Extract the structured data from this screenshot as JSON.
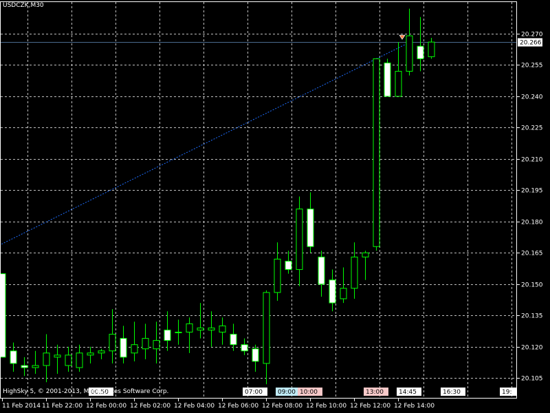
{
  "chart_data": {
    "type": "candlestick",
    "title": "USDCZK,M30",
    "ylim": [
      20.0955,
      20.2855
    ],
    "grid": true,
    "y_ticks": [
      "20.270",
      "20.255",
      "20.240",
      "20.225",
      "20.210",
      "20.195",
      "20.180",
      "20.165",
      "20.150",
      "20.135",
      "20.120",
      "20.105"
    ],
    "y_tick_values": [
      20.27,
      20.255,
      20.24,
      20.225,
      20.21,
      20.195,
      20.18,
      20.165,
      20.15,
      20.135,
      20.12,
      20.105
    ],
    "x_ticks": [
      "11 Feb 2014",
      "11 Feb 22:00",
      "12 Feb 00:00",
      "12 Feb 02:00",
      "12 Feb 04:00",
      "12 Feb 06:00",
      "12 Feb 08:00",
      "12 Feb 10:00",
      "12 Feb 12:00",
      "12 Feb 14:00"
    ],
    "candles": [
      {
        "o": 20.155,
        "h": 20.155,
        "l": 20.115,
        "c": 20.115
      },
      {
        "o": 20.118,
        "h": 20.122,
        "l": 20.108,
        "c": 20.112
      },
      {
        "o": 20.111,
        "h": 20.115,
        "l": 20.106,
        "c": 20.11
      },
      {
        "o": 20.11,
        "h": 20.118,
        "l": 20.107,
        "c": 20.111
      },
      {
        "o": 20.111,
        "h": 20.126,
        "l": 20.103,
        "c": 20.117
      },
      {
        "o": 20.115,
        "h": 20.121,
        "l": 20.107,
        "c": 20.116
      },
      {
        "o": 20.111,
        "h": 20.12,
        "l": 20.108,
        "c": 20.116
      },
      {
        "o": 20.11,
        "h": 20.121,
        "l": 20.108,
        "c": 20.117
      },
      {
        "o": 20.116,
        "h": 20.12,
        "l": 20.112,
        "c": 20.117
      },
      {
        "o": 20.117,
        "h": 20.119,
        "l": 20.114,
        "c": 20.118
      },
      {
        "o": 20.118,
        "h": 20.138,
        "l": 20.112,
        "c": 20.126
      },
      {
        "o": 20.124,
        "h": 20.13,
        "l": 20.112,
        "c": 20.115
      },
      {
        "o": 20.117,
        "h": 20.132,
        "l": 20.113,
        "c": 20.121
      },
      {
        "o": 20.119,
        "h": 20.131,
        "l": 20.114,
        "c": 20.124
      },
      {
        "o": 20.119,
        "h": 20.132,
        "l": 20.112,
        "c": 20.123
      },
      {
        "o": 20.128,
        "h": 20.137,
        "l": 20.118,
        "c": 20.123
      },
      {
        "o": 20.127,
        "h": 20.133,
        "l": 20.121,
        "c": 20.127
      },
      {
        "o": 20.127,
        "h": 20.134,
        "l": 20.117,
        "c": 20.131
      },
      {
        "o": 20.128,
        "h": 20.141,
        "l": 20.124,
        "c": 20.129
      },
      {
        "o": 20.128,
        "h": 20.137,
        "l": 20.12,
        "c": 20.129
      },
      {
        "o": 20.127,
        "h": 20.134,
        "l": 20.121,
        "c": 20.13
      },
      {
        "o": 20.126,
        "h": 20.131,
        "l": 20.118,
        "c": 20.121
      },
      {
        "o": 20.121,
        "h": 20.124,
        "l": 20.116,
        "c": 20.118
      },
      {
        "o": 20.119,
        "h": 20.121,
        "l": 20.108,
        "c": 20.113
      },
      {
        "o": 20.112,
        "h": 20.147,
        "l": 20.102,
        "c": 20.146
      },
      {
        "o": 20.146,
        "h": 20.17,
        "l": 20.142,
        "c": 20.162
      },
      {
        "o": 20.161,
        "h": 20.166,
        "l": 20.155,
        "c": 20.157
      },
      {
        "o": 20.157,
        "h": 20.192,
        "l": 20.149,
        "c": 20.186
      },
      {
        "o": 20.186,
        "h": 20.194,
        "l": 20.165,
        "c": 20.168
      },
      {
        "o": 20.163,
        "h": 20.166,
        "l": 20.144,
        "c": 20.15
      },
      {
        "o": 20.152,
        "h": 20.157,
        "l": 20.137,
        "c": 20.141
      },
      {
        "o": 20.143,
        "h": 20.158,
        "l": 20.141,
        "c": 20.148
      },
      {
        "o": 20.148,
        "h": 20.17,
        "l": 20.143,
        "c": 20.163
      },
      {
        "o": 20.163,
        "h": 20.166,
        "l": 20.152,
        "c": 20.165
      },
      {
        "o": 20.168,
        "h": 20.258,
        "l": 20.166,
        "c": 20.258
      },
      {
        "o": 20.256,
        "h": 20.258,
        "l": 20.24,
        "c": 20.24
      },
      {
        "o": 20.24,
        "h": 20.266,
        "l": 20.24,
        "c": 20.252
      },
      {
        "o": 20.252,
        "h": 20.282,
        "l": 20.25,
        "c": 20.269
      },
      {
        "o": 20.264,
        "h": 20.278,
        "l": 20.252,
        "c": 20.258
      },
      {
        "o": 20.259,
        "h": 20.268,
        "l": 20.258,
        "c": 20.266
      }
    ],
    "current_price": 20.266,
    "current_price_label": "20.266",
    "trendline": {
      "from_index": -0.5,
      "from_price": 20.168,
      "to_index": 37.1,
      "to_price": 20.266
    },
    "time_markers": [
      {
        "label": "00:50",
        "after_index": 9
      },
      {
        "label": "07:00",
        "after_index": 23
      },
      {
        "label": "09:00",
        "after_index": 26
      },
      {
        "label": "10:00",
        "after_index": 28
      },
      {
        "label": "13:00",
        "after_index": 34
      },
      {
        "label": "14:45",
        "after_index": 37
      },
      {
        "label": "16:30",
        "after_index": 41
      },
      {
        "label": "19:",
        "after_index": 46
      }
    ],
    "copyright": "HighSky 5, © 2001-2013, MetaQuotes Software Corp.",
    "colors": {
      "grid": "#c0c0c0",
      "axis": "#ffffff",
      "bull_fill": "#000000",
      "bear_fill": "#ffffff",
      "candle_border": "#00ff00",
      "trendline": "#1e6eff",
      "price_line": "#4b6b8f",
      "marker_bg": "#ffffff",
      "marker_09": "#bfeaf5",
      "marker_10": "#f7c9c9",
      "marker_13": "#f7c9c9",
      "arrow": "#ff7a3c"
    }
  }
}
